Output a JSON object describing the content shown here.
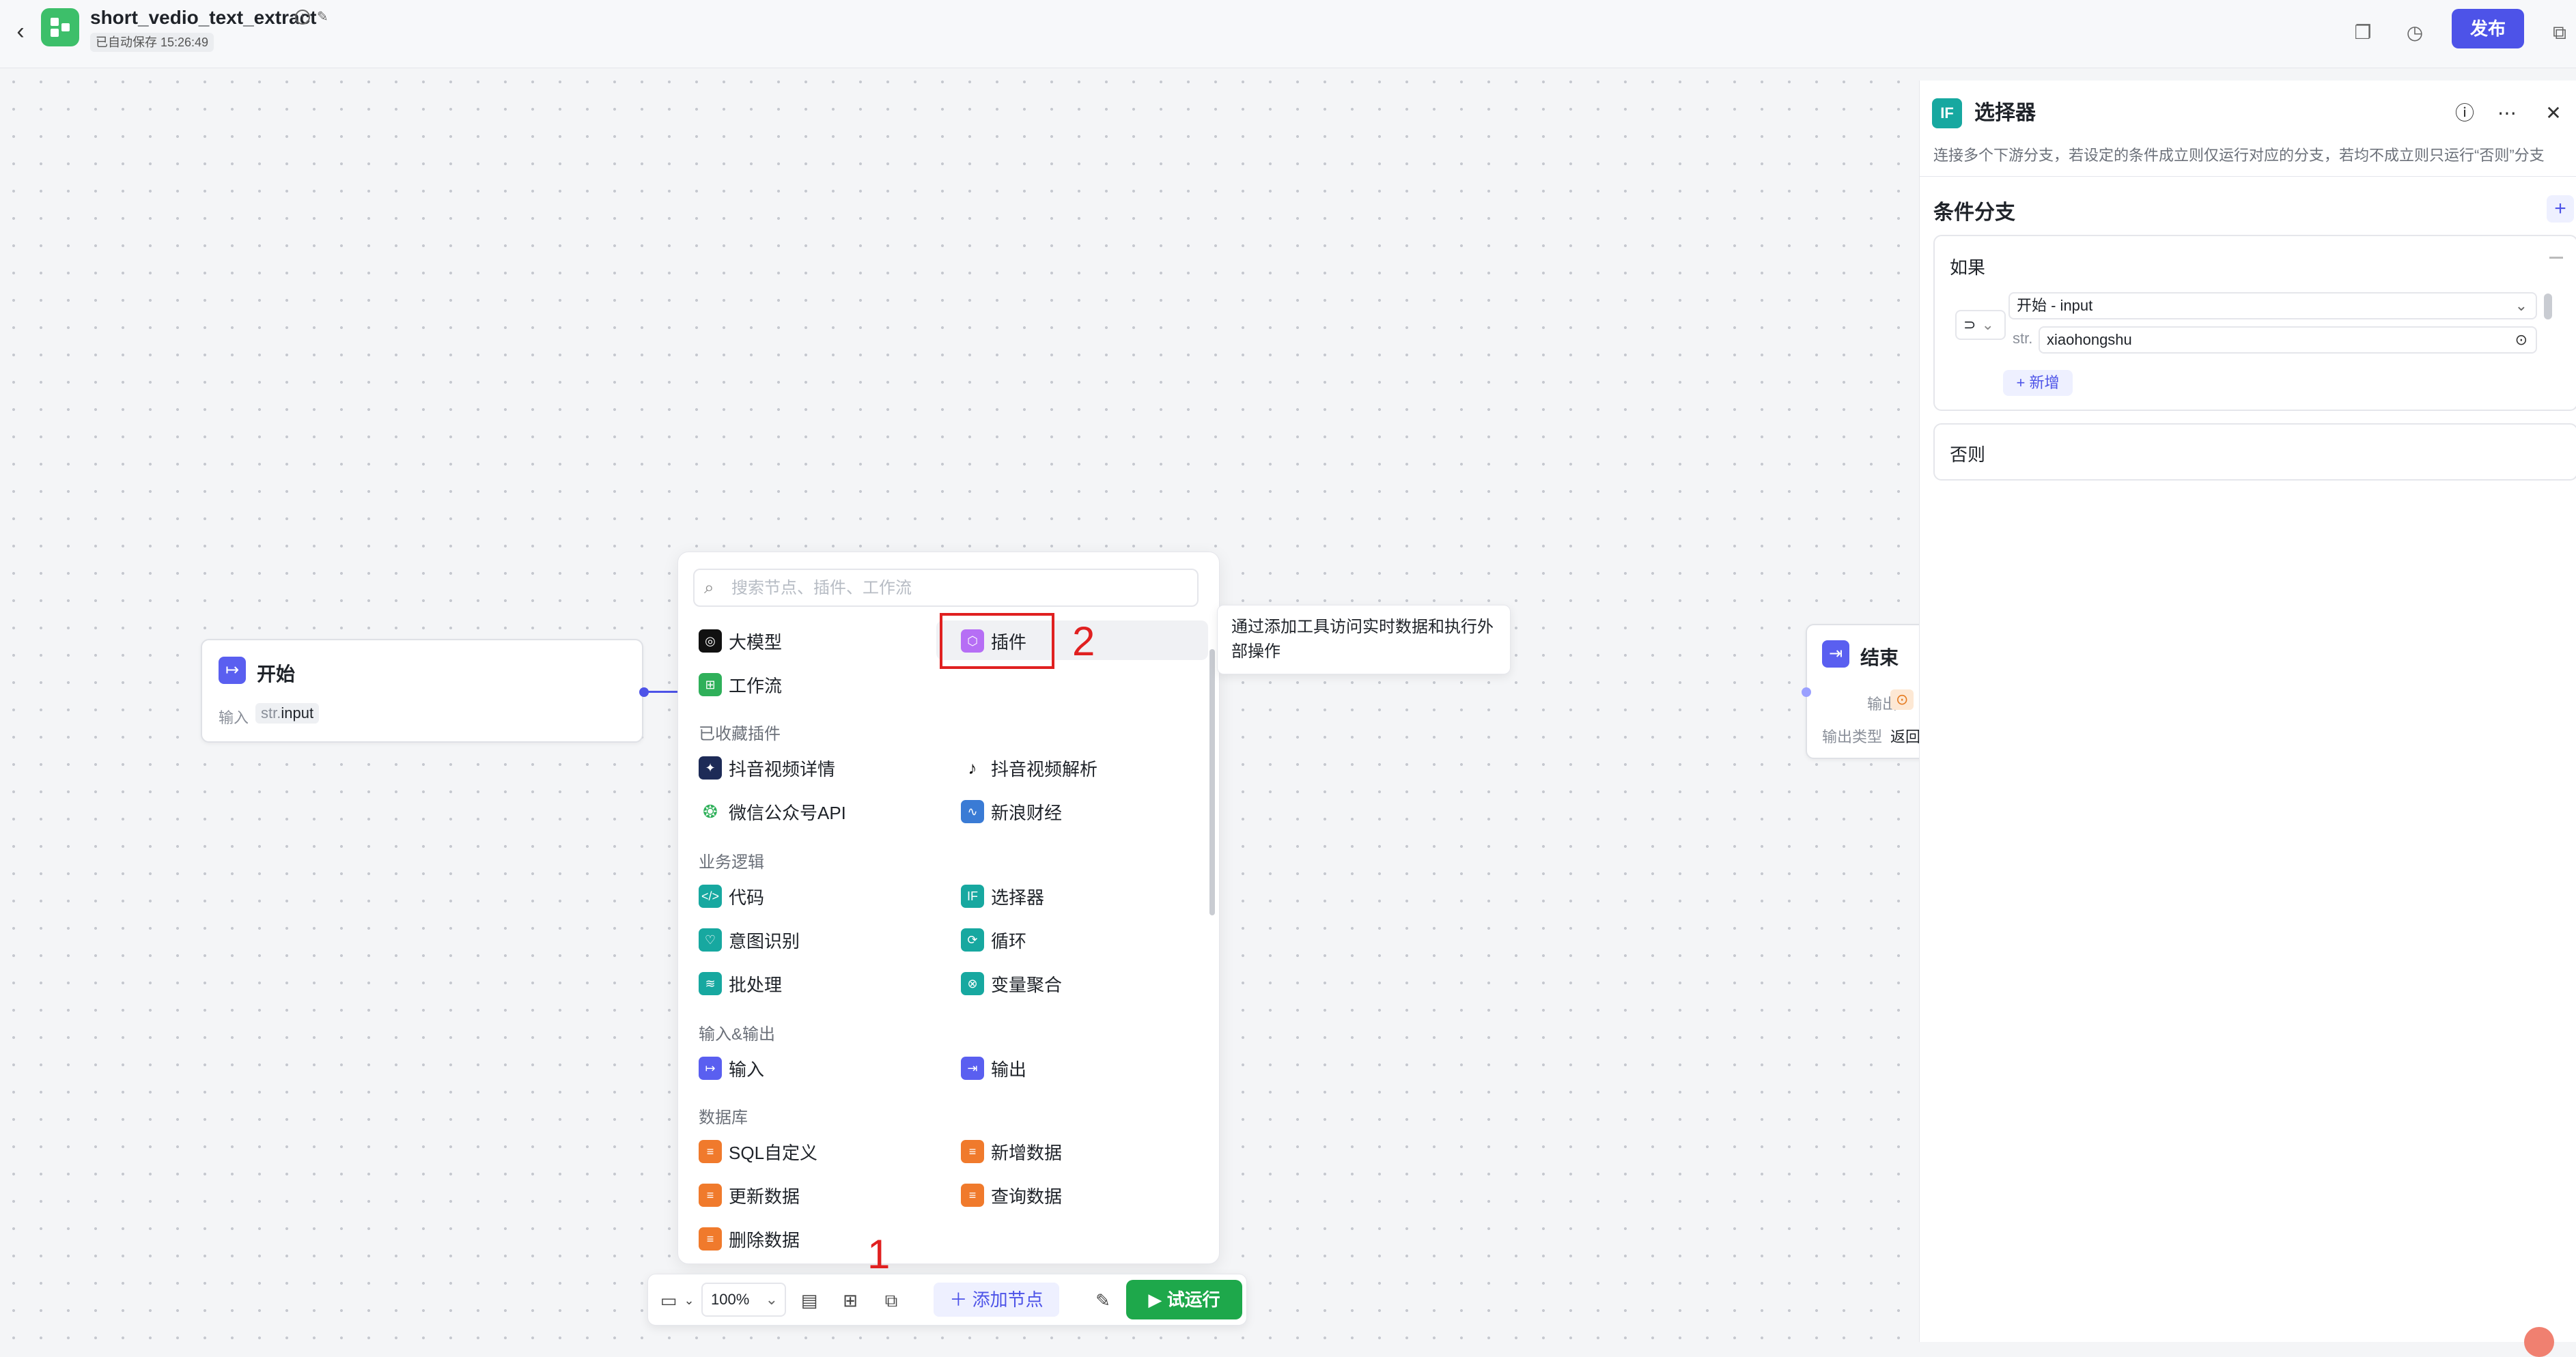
{
  "header": {
    "app_title": "short_vedio_text_extract",
    "autosave_label": "已自动保存 15:26:49",
    "publish_label": "发布"
  },
  "nodes": {
    "start": {
      "title": "开始",
      "input_label": "输入",
      "input_type": "str.",
      "input_name": "input"
    },
    "end": {
      "title": "结束",
      "output_label": "输出",
      "output_type_label": "输出类型",
      "output_type_value": "返回"
    }
  },
  "add_menu": {
    "search_placeholder": "搜索节点、插件、工作流",
    "top_items": [
      "大模型",
      "插件",
      "工作流"
    ],
    "sections": [
      {
        "title": "已收藏插件",
        "items": [
          "抖音视频详情",
          "抖音视频解析",
          "微信公众号API",
          "新浪财经"
        ]
      },
      {
        "title": "业务逻辑",
        "items": [
          "代码",
          "选择器",
          "意图识别",
          "循环",
          "批处理",
          "变量聚合"
        ]
      },
      {
        "title": "输入&输出",
        "items": [
          "输入",
          "输出"
        ]
      },
      {
        "title": "数据库",
        "items": [
          "SQL自定义",
          "新增数据",
          "更新数据",
          "查询数据",
          "删除数据"
        ]
      }
    ],
    "tooltip": "通过添加工具访问实时数据和执行外部操作"
  },
  "annotations": {
    "one": "1",
    "two": "2"
  },
  "bottombar": {
    "zoom": "100%",
    "add_node_label": "添加节点",
    "run_label": "试运行"
  },
  "panel": {
    "icon_text": "IF",
    "title": "选择器",
    "description": "连接多个下游分支，若设定的条件成立则仅运行对应的分支，若均不成立则只运行“否则”分支",
    "branch_title": "条件分支",
    "if_label": "如果",
    "operator_symbol": "⊃",
    "left_value": "开始 - input",
    "right_type": "str.",
    "right_value": "xiaohongshu",
    "add_condition_label": "+ 新增",
    "else_label": "否则"
  },
  "colors": {
    "primary": "#4d53e8",
    "run": "#1ea84b",
    "annotation": "#e02020",
    "selector_icon": "#17a8a0"
  }
}
